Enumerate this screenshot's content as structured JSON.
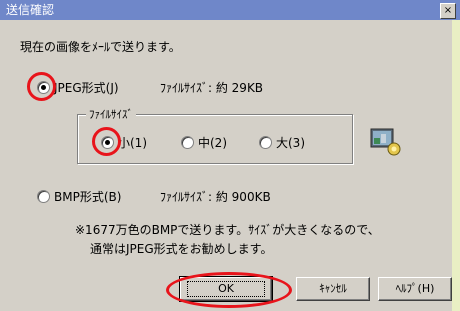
{
  "titlebar": {
    "title": "送信確認",
    "close_glyph": "×"
  },
  "dialog": {
    "message": "現在の画像をﾒｰﾙで送ります。",
    "jpeg_option": {
      "label": "JPEG形式(J)",
      "filesize": "ﾌｧｲﾙｻｲｽﾞ: 約 29KB",
      "selected": true
    },
    "size_group": {
      "title": "ﾌｧｲﾙｻｲｽﾞ",
      "options": [
        {
          "label": "小(1)",
          "selected": true
        },
        {
          "label": "中(2)",
          "selected": false
        },
        {
          "label": "大(3)",
          "selected": false
        }
      ]
    },
    "bmp_option": {
      "label": "BMP形式(B)",
      "filesize": "ﾌｧｲﾙｻｲｽﾞ: 約 900KB",
      "selected": false
    },
    "note_line1": "※1677万色のBMPで送ります。ｻｲｽﾞが大きくなるので、",
    "note_line2": "通常はJPEG形式をお勧めします。",
    "buttons": {
      "ok": "OK",
      "cancel": "ｷｬﾝｾﾙ",
      "help": "ﾍﾙﾌﾟ(H)"
    }
  },
  "colors": {
    "annotation_circle": "#e8141b",
    "titlebar": "#6f87c9",
    "face": "#d4d0c8",
    "margin": "#e9efc4"
  }
}
